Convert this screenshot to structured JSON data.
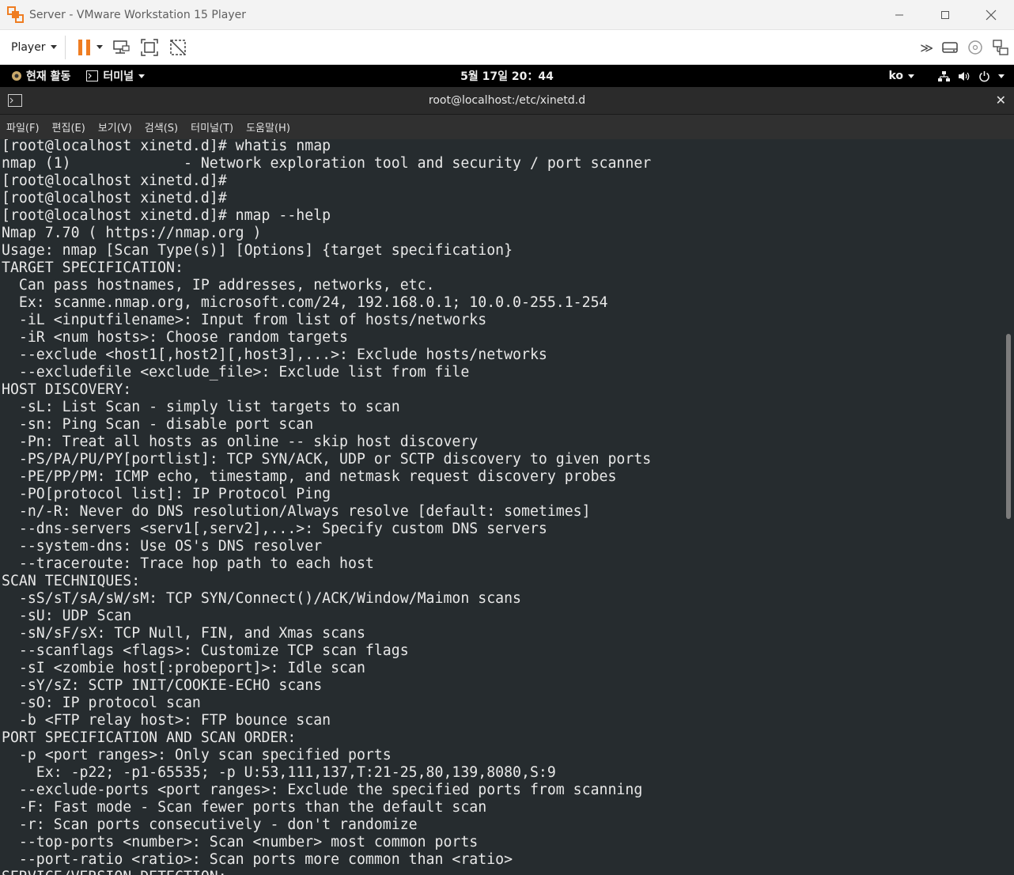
{
  "host_window": {
    "title": "Server - VMware Workstation 15 Player",
    "brand_color": "#ef7d22"
  },
  "player_toolbar": {
    "player_menu_label": "Player",
    "icons": [
      "pause-icon",
      "send-ctrl-alt-del-icon",
      "full-screen-icon",
      "unity-icon",
      "more-icon",
      "hard-disk-icon",
      "cd-icon",
      "network-adapter-icon"
    ]
  },
  "gnome_bar": {
    "activities_label": "현재 활동",
    "app_menu_label": "터미널",
    "clock": "5월 17일  20：44",
    "input_method": "ko"
  },
  "terminal": {
    "title": "root@localhost:/etc/xinetd.d",
    "menu": [
      "파일(F)",
      "편집(E)",
      "보기(V)",
      "검색(S)",
      "터미널(T)",
      "도움말(H)"
    ],
    "lines": [
      "[root@localhost xinetd.d]# whatis nmap",
      "nmap (1)             - Network exploration tool and security / port scanner",
      "[root@localhost xinetd.d]#",
      "[root@localhost xinetd.d]#",
      "[root@localhost xinetd.d]# nmap --help",
      "Nmap 7.70 ( https://nmap.org )",
      "Usage: nmap [Scan Type(s)] [Options] {target specification}",
      "TARGET SPECIFICATION:",
      "  Can pass hostnames, IP addresses, networks, etc.",
      "  Ex: scanme.nmap.org, microsoft.com/24, 192.168.0.1; 10.0.0-255.1-254",
      "  -iL <inputfilename>: Input from list of hosts/networks",
      "  -iR <num hosts>: Choose random targets",
      "  --exclude <host1[,host2][,host3],...>: Exclude hosts/networks",
      "  --excludefile <exclude_file>: Exclude list from file",
      "HOST DISCOVERY:",
      "  -sL: List Scan - simply list targets to scan",
      "  -sn: Ping Scan - disable port scan",
      "  -Pn: Treat all hosts as online -- skip host discovery",
      "  -PS/PA/PU/PY[portlist]: TCP SYN/ACK, UDP or SCTP discovery to given ports",
      "  -PE/PP/PM: ICMP echo, timestamp, and netmask request discovery probes",
      "  -PO[protocol list]: IP Protocol Ping",
      "  -n/-R: Never do DNS resolution/Always resolve [default: sometimes]",
      "  --dns-servers <serv1[,serv2],...>: Specify custom DNS servers",
      "  --system-dns: Use OS's DNS resolver",
      "  --traceroute: Trace hop path to each host",
      "SCAN TECHNIQUES:",
      "  -sS/sT/sA/sW/sM: TCP SYN/Connect()/ACK/Window/Maimon scans",
      "  -sU: UDP Scan",
      "  -sN/sF/sX: TCP Null, FIN, and Xmas scans",
      "  --scanflags <flags>: Customize TCP scan flags",
      "  -sI <zombie host[:probeport]>: Idle scan",
      "  -sY/sZ: SCTP INIT/COOKIE-ECHO scans",
      "  -sO: IP protocol scan",
      "  -b <FTP relay host>: FTP bounce scan",
      "PORT SPECIFICATION AND SCAN ORDER:",
      "  -p <port ranges>: Only scan specified ports",
      "    Ex: -p22; -p1-65535; -p U:53,111,137,T:21-25,80,139,8080,S:9",
      "  --exclude-ports <port ranges>: Exclude the specified ports from scanning",
      "  -F: Fast mode - Scan fewer ports than the default scan",
      "  -r: Scan ports consecutively - don't randomize",
      "  --top-ports <number>: Scan <number> most common ports",
      "  --port-ratio <ratio>: Scan ports more common than <ratio>",
      "SERVICE/VERSION DETECTION:"
    ]
  }
}
